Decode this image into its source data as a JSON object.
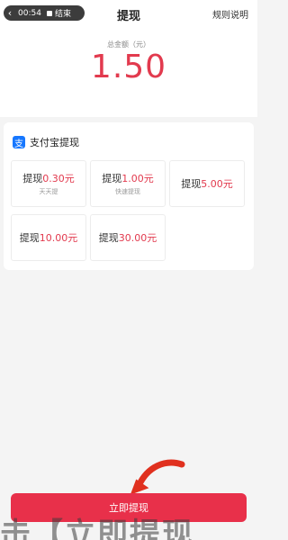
{
  "status_bar": {
    "back_icon": "chevron-left-icon",
    "time": "00:54",
    "end_label": "结束"
  },
  "header": {
    "title": "提现",
    "rules_link": "规则说明"
  },
  "summary": {
    "label": "总金额（元）",
    "amount": "1.50"
  },
  "payment_method": {
    "icon": "alipay-icon",
    "icon_glyph": "支",
    "label": "支付宝提现"
  },
  "options": [
    {
      "prefix": "提现",
      "amount": "0.30元",
      "sub": "天天提"
    },
    {
      "prefix": "提现",
      "amount": "1.00元",
      "sub": "快速提现"
    },
    {
      "prefix": "提现",
      "amount": "5.00元",
      "sub": ""
    },
    {
      "prefix": "提现",
      "amount": "10.00元",
      "sub": ""
    },
    {
      "prefix": "提现",
      "amount": "30.00元",
      "sub": ""
    }
  ],
  "withdraw_button": {
    "label": "立即提现"
  },
  "caption_overlay": "击【立即提现",
  "colors": {
    "accent": "#e23a4e",
    "button": "#e8304a",
    "alipay_blue": "#1677ff"
  }
}
